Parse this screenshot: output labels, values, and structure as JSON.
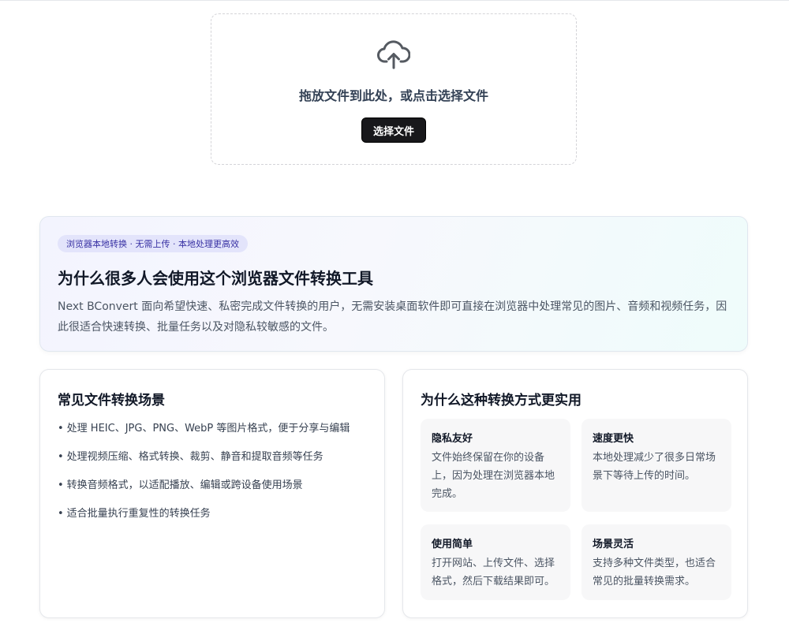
{
  "upload": {
    "icon": "cloud-upload-icon",
    "prompt": "拖放文件到此处，或点击选择文件",
    "button_label": "选择文件"
  },
  "intro": {
    "badge": "浏览器本地转换 · 无需上传 · 本地处理更高效",
    "title": "为什么很多人会使用这个浏览器文件转换工具",
    "description": "Next BConvert 面向希望快速、私密完成文件转换的用户，无需安装桌面软件即可直接在浏览器中处理常见的图片、音频和视频任务，因此很适合快速转换、批量任务以及对隐私较敏感的文件。"
  },
  "scenarios": {
    "title": "常见文件转换场景",
    "items": [
      "处理 HEIC、JPG、PNG、WebP 等图片格式，便于分享与编辑",
      "处理视频压缩、格式转换、裁剪、静音和提取音频等任务",
      "转换音频格式，以适配播放、编辑或跨设备使用场景",
      "适合批量执行重复性的转换任务"
    ]
  },
  "benefits": {
    "title": "为什么这种转换方式更实用",
    "items": [
      {
        "title": "隐私友好",
        "desc": "文件始终保留在你的设备上，因为处理在浏览器本地完成。"
      },
      {
        "title": "速度更快",
        "desc": "本地处理减少了很多日常场景下等待上传的时间。"
      },
      {
        "title": "使用简单",
        "desc": "打开网站、上传文件、选择格式，然后下载结果即可。"
      },
      {
        "title": "场景灵活",
        "desc": "支持多种文件类型，也适合常见的批量转换需求。"
      }
    ]
  },
  "colors": {
    "button_bg": "#18181b",
    "badge_bg": "#e3e4fb",
    "badge_text": "#3730a3"
  }
}
